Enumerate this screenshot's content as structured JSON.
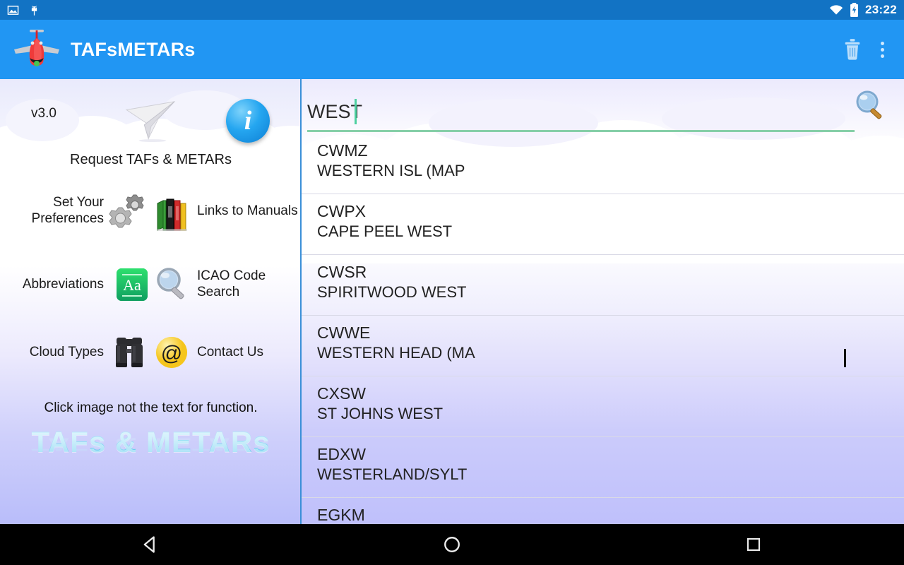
{
  "status_bar": {
    "time": "23:22",
    "icons": [
      "image-icon",
      "android-head-icon",
      "wifi-icon",
      "battery-charging-icon"
    ]
  },
  "app_bar": {
    "title": "TAFsMETARs",
    "logo_icon": "red-airplane-icon",
    "actions": [
      {
        "name": "delete-button",
        "icon": "trash-icon"
      },
      {
        "name": "overflow-menu-button",
        "icon": "three-dots-vertical-icon"
      }
    ]
  },
  "left_panel": {
    "version": "v3.0",
    "request_label": "Request TAFs & METARs",
    "request_icon": "paper-plane-icon",
    "info_icon": "info-circle-icon",
    "info_glyph": "i",
    "menu": [
      {
        "label": "Set Your Preferences",
        "icon": "gears-icon",
        "align": "right"
      },
      {
        "label": "Links to Manuals",
        "icon": "books-icon",
        "align": "left"
      },
      {
        "label": "Abbreviations",
        "icon": "abbreviations-aa-icon",
        "align": "right"
      },
      {
        "label": "ICAO Code Search",
        "icon": "magnifier-icon",
        "align": "left"
      },
      {
        "label": "Cloud Types",
        "icon": "binoculars-icon",
        "align": "right"
      },
      {
        "label": "Contact Us",
        "icon": "at-sign-icon",
        "align": "left"
      }
    ],
    "footnote": "Click image not the text for function.",
    "logo_text": "TAFs & METARs"
  },
  "search": {
    "value": "WEST",
    "placeholder": "",
    "icon": "magnifier-search-icon"
  },
  "results": [
    {
      "code": "CWMZ",
      "name": "WESTERN ISL (MAP"
    },
    {
      "code": "CWPX",
      "name": "CAPE PEEL WEST"
    },
    {
      "code": "CWSR",
      "name": "SPIRITWOOD WEST"
    },
    {
      "code": "CWWE",
      "name": "WESTERN HEAD (MA"
    },
    {
      "code": "CXSW",
      "name": "ST JOHNS WEST"
    },
    {
      "code": "EDXW",
      "name": "WESTERLAND/SYLT"
    },
    {
      "code": "EGKM",
      "name": ""
    }
  ],
  "nav_bar": [
    {
      "name": "back-button",
      "icon": "triangle-back-icon"
    },
    {
      "name": "home-button",
      "icon": "circle-home-icon"
    },
    {
      "name": "recents-button",
      "icon": "square-recents-icon"
    }
  ],
  "colors": {
    "status_bar": "#1273c4",
    "app_bar": "#2196f3",
    "accent_underline": "#86cfa8",
    "caret": "#4dd0a0",
    "panel_divider": "#3a8fd8"
  }
}
